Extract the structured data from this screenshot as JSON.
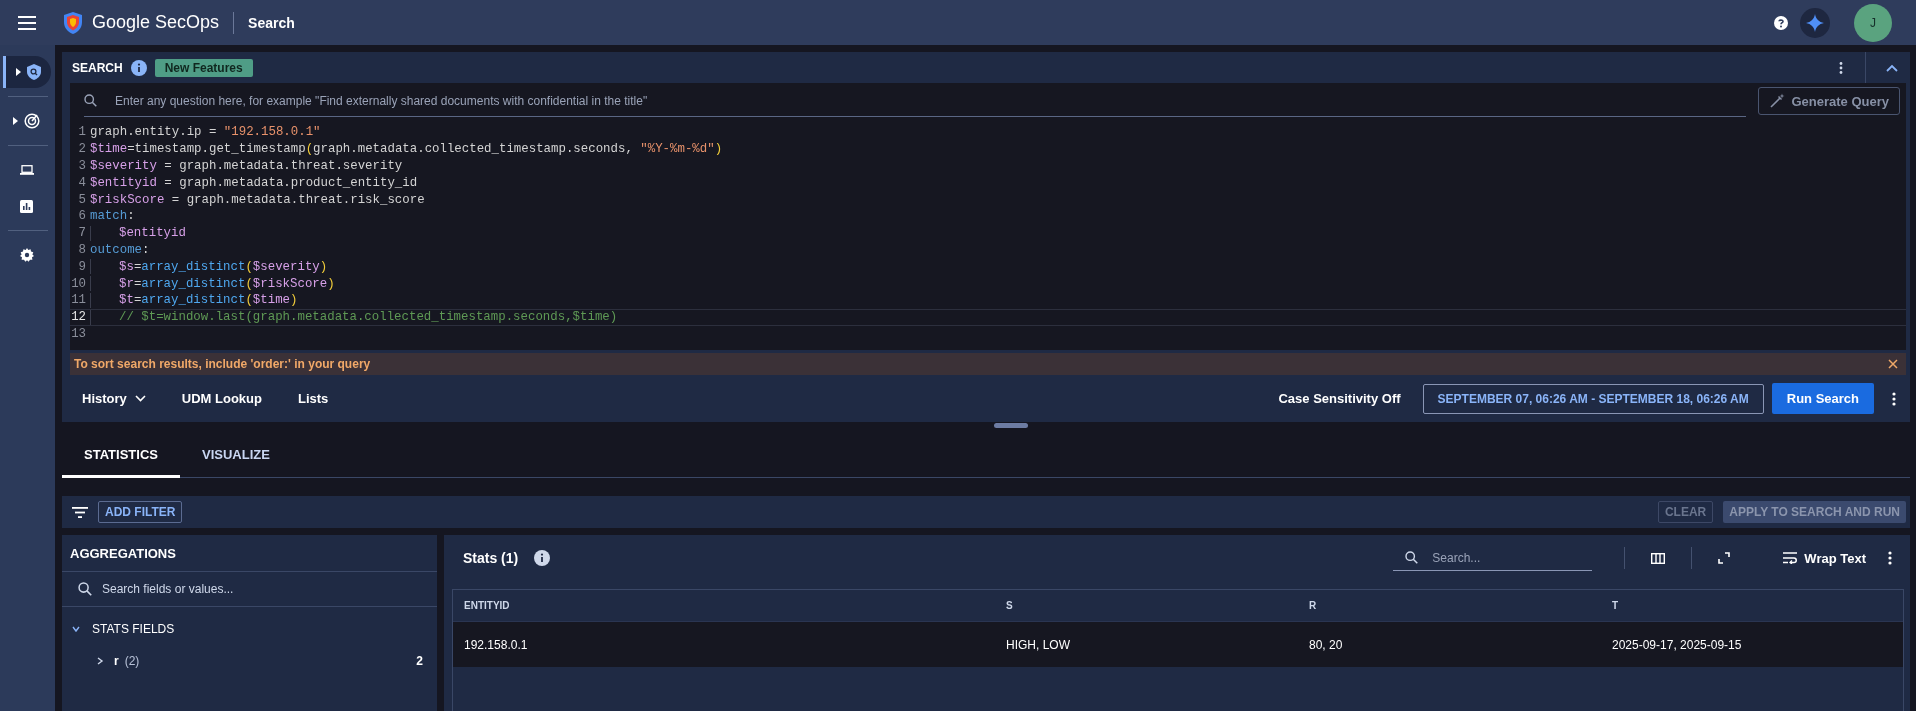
{
  "app_bar": {
    "product": "Google SecOps",
    "page": "Search",
    "avatar_initial": "J"
  },
  "sidebar": {
    "items": [
      {
        "selected": true,
        "expandable": true
      },
      {
        "selected": false,
        "expandable": true
      },
      {
        "selected": false,
        "expandable": false
      },
      {
        "selected": false,
        "expandable": false
      },
      {
        "selected": false,
        "expandable": false
      }
    ]
  },
  "search_panel": {
    "title": "SEARCH",
    "badge": "New Features",
    "ai_prompt": {
      "placeholder": "Enter any question here, for example \"Find externally shared documents with confidential in the title\""
    },
    "generate_button": {
      "label": "Generate Query",
      "disabled": true
    },
    "code_lines": [
      {
        "number": "1",
        "current": false,
        "indent": false,
        "tokens": [
          {
            "kind": "plain",
            "text": "graph.entity.ip = "
          },
          {
            "kind": "string",
            "text": "\"192.158.0.1\""
          }
        ]
      },
      {
        "number": "2",
        "current": false,
        "indent": false,
        "tokens": [
          {
            "kind": "var",
            "text": "$time"
          },
          {
            "kind": "plain",
            "text": "=timestamp.get_timestamp"
          },
          {
            "kind": "paren",
            "text": "("
          },
          {
            "kind": "plain",
            "text": "graph.metadata.collected_timestamp.seconds, "
          },
          {
            "kind": "string",
            "text": "\"%Y-%m-%d\""
          },
          {
            "kind": "paren",
            "text": ")"
          }
        ]
      },
      {
        "number": "3",
        "current": false,
        "indent": false,
        "tokens": [
          {
            "kind": "var",
            "text": "$severity"
          },
          {
            "kind": "plain",
            "text": " = graph.metadata.threat.severity"
          }
        ]
      },
      {
        "number": "4",
        "current": false,
        "indent": false,
        "tokens": [
          {
            "kind": "var",
            "text": "$entityid"
          },
          {
            "kind": "plain",
            "text": " = graph.metadata.product_entity_id"
          }
        ]
      },
      {
        "number": "5",
        "current": false,
        "indent": false,
        "tokens": [
          {
            "kind": "var",
            "text": "$riskScore"
          },
          {
            "kind": "plain",
            "text": " = graph.metadata.threat.risk_score"
          }
        ]
      },
      {
        "number": "6",
        "current": false,
        "indent": false,
        "tokens": [
          {
            "kind": "keyword",
            "text": "match"
          },
          {
            "kind": "plain",
            "text": ":"
          }
        ]
      },
      {
        "number": "7",
        "current": false,
        "indent": true,
        "tokens": [
          {
            "kind": "var",
            "text": "$entityid"
          }
        ]
      },
      {
        "number": "8",
        "current": false,
        "indent": false,
        "tokens": [
          {
            "kind": "keyword",
            "text": "outcome"
          },
          {
            "kind": "plain",
            "text": ":"
          }
        ]
      },
      {
        "number": "9",
        "current": false,
        "indent": true,
        "tokens": [
          {
            "kind": "var",
            "text": "$s"
          },
          {
            "kind": "plain",
            "text": "="
          },
          {
            "kind": "func",
            "text": "array_distinct"
          },
          {
            "kind": "paren",
            "text": "("
          },
          {
            "kind": "var",
            "text": "$severity"
          },
          {
            "kind": "paren",
            "text": ")"
          }
        ]
      },
      {
        "number": "10",
        "current": false,
        "indent": true,
        "tokens": [
          {
            "kind": "var",
            "text": "$r"
          },
          {
            "kind": "plain",
            "text": "="
          },
          {
            "kind": "func",
            "text": "array_distinct"
          },
          {
            "kind": "paren",
            "text": "("
          },
          {
            "kind": "var",
            "text": "$riskScore"
          },
          {
            "kind": "paren",
            "text": ")"
          }
        ]
      },
      {
        "number": "11",
        "current": false,
        "indent": true,
        "tokens": [
          {
            "kind": "var",
            "text": "$t"
          },
          {
            "kind": "plain",
            "text": "="
          },
          {
            "kind": "func",
            "text": "array_distinct"
          },
          {
            "kind": "paren",
            "text": "("
          },
          {
            "kind": "var",
            "text": "$time"
          },
          {
            "kind": "paren",
            "text": ")"
          }
        ]
      },
      {
        "number": "12",
        "current": true,
        "indent": true,
        "tokens": [
          {
            "kind": "comment",
            "text": "// $t=window.last(graph.metadata.collected_timestamp.seconds,$time)"
          }
        ]
      },
      {
        "number": "13",
        "current": false,
        "indent": false
      }
    ],
    "notice": "To sort search results, include 'order:' in your query",
    "links": [
      {
        "label": "History",
        "dropdown": true
      },
      {
        "label": "UDM Lookup",
        "dropdown": false
      },
      {
        "label": "Lists",
        "dropdown": false
      }
    ],
    "case_sensitivity": "Case Sensitivity Off",
    "time_range": "SEPTEMBER 07, 06:26 AM - SEPTEMBER 18, 06:26 AM",
    "run_button": "Run Search"
  },
  "results": {
    "tabs": [
      {
        "label": "STATISTICS",
        "selected": true
      },
      {
        "label": "VISUALIZE",
        "selected": false
      }
    ],
    "add_filter": "ADD FILTER",
    "clear_button": {
      "label": "CLEAR",
      "disabled": true
    },
    "apply_button": {
      "label": "APPLY TO SEARCH AND RUN",
      "disabled": true
    },
    "aggregations": {
      "title": "AGGREGATIONS",
      "search": {
        "placeholder": "Search fields or values..."
      },
      "sections": [
        {
          "label": "STATS FIELDS",
          "expanded": true,
          "fields": [
            {
              "name": "r",
              "count_label": "(2)",
              "count": "2",
              "expanded": false
            }
          ]
        }
      ]
    },
    "stats": {
      "title": "Stats (1)",
      "search": {
        "placeholder": "Search..."
      },
      "wrap_text": "Wrap Text",
      "table": {
        "columns": [
          "ENTITYID",
          "S",
          "R",
          "T"
        ],
        "rows": [
          [
            "192.158.0.1",
            "HIGH, LOW",
            "80, 20",
            "2025-09-17, 2025-09-15"
          ]
        ]
      }
    }
  }
}
